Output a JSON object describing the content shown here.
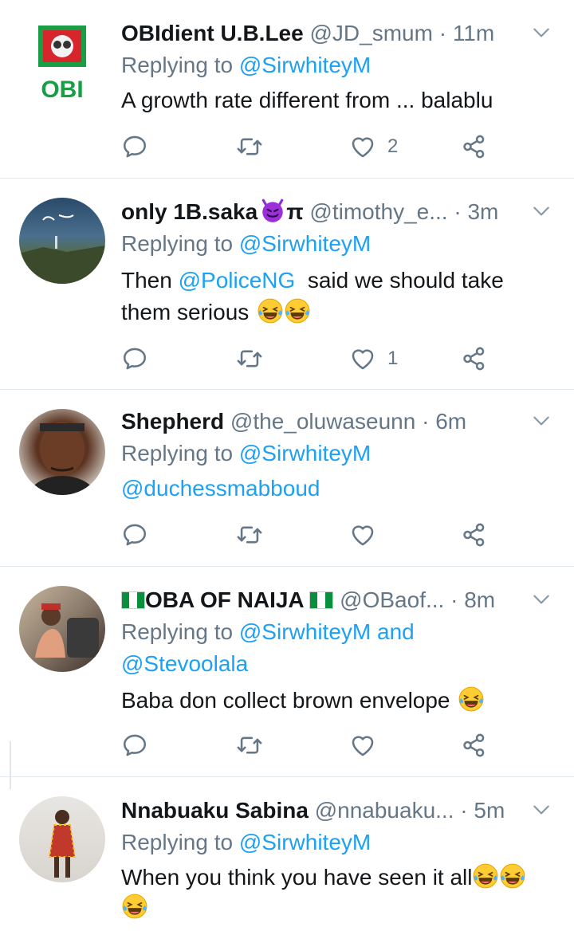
{
  "colors": {
    "link": "#1da1f2",
    "muted": "#657786",
    "text": "#14171a",
    "divider": "#e1e8ed"
  },
  "tweets": [
    {
      "name": "OBIdient U.B.Lee",
      "handle": "@JD_smum",
      "time": "11m",
      "replying_prefix": "Replying to",
      "replying_to": "@SirwhiteyM",
      "avatar_text": "OBI",
      "text": "A growth rate different from ... balablu",
      "likes": "2"
    },
    {
      "name": "only 1B.saka",
      "name_emoji": "smiling-devil",
      "name_suffix": "π",
      "handle": "@timothy_e...",
      "time": "3m",
      "replying_prefix": "Replying to",
      "replying_to": "@SirwhiteyM",
      "text_mention": "@PoliceNG",
      "text_after_mention": "said we should take",
      "text_line2": "them serious",
      "likes": "1"
    },
    {
      "name": "Shepherd",
      "handle": "@the_oluwaseunn",
      "time": "6m",
      "replying_prefix": "Replying to",
      "replying_to": "@SirwhiteyM",
      "text_mention": "@duchessmabboud",
      "likes": ""
    },
    {
      "name": "OBA OF NAIJA",
      "flag": "nigeria-flag",
      "handle": "@OBaof...",
      "time": "8m",
      "replying_prefix": "Replying to",
      "replying_to": "@SirwhiteyM",
      "replying_and": "and",
      "replying_to2": "@Stevoolala",
      "text": "Baba don collect brown envelope",
      "likes": ""
    },
    {
      "name": "Nnabuaku Sabina",
      "handle": "@nnabuaku...",
      "time": "5m",
      "replying_prefix": "Replying to",
      "replying_to": "@SirwhiteyM",
      "text": "When you think you have seen it all",
      "likes": ""
    }
  ],
  "icons": {
    "reply": "reply-icon",
    "retweet": "retweet-icon",
    "like": "heart-icon",
    "share": "share-icon",
    "menu": "chevron-down-icon",
    "emoji": "laughing-emoji"
  }
}
